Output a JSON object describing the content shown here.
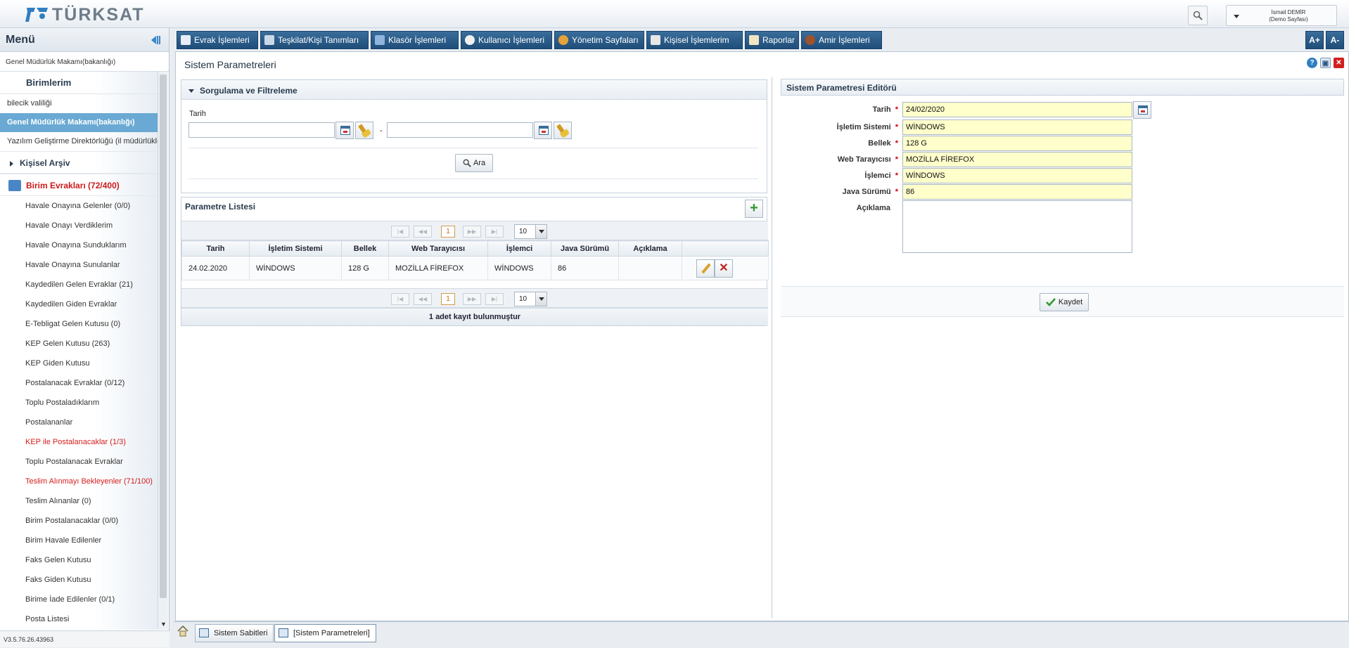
{
  "header": {
    "logo_text": "TÜRKSAT",
    "user_name": "İsmail DEMİR",
    "user_sub": "(Demo Sayfası)"
  },
  "sidebar": {
    "title": "Menü",
    "unit_select": "Genel Müdürlük Makamı(bakanlığı)",
    "birimlerim_label": "Birimlerim",
    "units": [
      "bilecik valiliği",
      "Genel Müdürlük Makamı(bakanlığı)",
      "Yazılım Geliştirme Direktörlüğü (il müdürlükleri)"
    ],
    "kisisel_arsiv": "Kişisel Arşiv",
    "birim_evraklari": "Birim Evrakları (72/400)",
    "items": [
      "Havale Onayına Gelenler (0/0)",
      "Havale Onayı Verdiklerim",
      "Havale Onayına Sunduklarım",
      "Havale Onayına Sunulanlar",
      "Kaydedilen Gelen Evraklar (21)",
      "Kaydedilen Giden Evraklar",
      "E-Tebligat Gelen Kutusu (0)",
      "KEP Gelen Kutusu (263)",
      "KEP Giden Kutusu",
      "Postalanacak Evraklar (0/12)",
      "Toplu Postaladıklarım",
      "Postalananlar",
      "KEP ile Postalanacaklar (1/3)",
      "Toplu Postalanacak Evraklar",
      "Teslim Alınmayı Bekleyenler (71/100)",
      "Teslim Alınanlar (0)",
      "Birim Postalanacaklar (0/0)",
      "Birim Havale Edilenler",
      "Faks Gelen Kutusu",
      "Faks Giden Kutusu",
      "Birime İade Edilenler (0/1)",
      "Posta Listesi"
    ],
    "version": "V3.5.76.26.43963"
  },
  "nav": {
    "items": [
      "Evrak İşlemleri",
      "Teşkilat/Kişi Tanımları",
      "Klasör İşlemleri",
      "Kullanıcı İşlemleri",
      "Yönetim Sayfaları",
      "Kişisel İşlemlerim",
      "Raporlar",
      "Amir İşlemleri"
    ],
    "font_up": "A+",
    "font_down": "A-"
  },
  "page": {
    "title": "Sistem Parametreleri"
  },
  "filter": {
    "title": "Sorgulama ve Filtreleme",
    "tarih_label": "Tarih",
    "dash": "-",
    "search_button": "Ara"
  },
  "list": {
    "title": "Parametre Listesi",
    "current_page": "1",
    "page_size": "10",
    "columns": [
      "Tarih",
      "İşletim Sistemi",
      "Bellek",
      "Web Tarayıcısı",
      "İşlemci",
      "Java Sürümü",
      "Açıklama"
    ],
    "rows": [
      [
        "24.02.2020",
        "WİNDOWS",
        "128 G",
        "MOZİLLA FİREFOX",
        "WİNDOWS",
        "86",
        ""
      ]
    ],
    "footer": "1 adet kayıt bulunmuştur"
  },
  "editor": {
    "title": "Sistem Parametresi Editörü",
    "fields": [
      {
        "label": "Tarih",
        "value": "24/02/2020"
      },
      {
        "label": "İşletim Sistemi",
        "value": "WİNDOWS"
      },
      {
        "label": "Bellek",
        "value": "128 G"
      },
      {
        "label": "Web Tarayıcısı",
        "value": "MOZİLLA FİREFOX"
      },
      {
        "label": "İşlemci",
        "value": "WİNDOWS"
      },
      {
        "label": "Java Sürümü",
        "value": "86"
      }
    ],
    "aciklama_label": "Açıklama",
    "required_mark": "*",
    "save_button": "Kaydet"
  },
  "bottom_tabs": [
    "Sistem Sabitleri",
    "[Sistem Parametreleri]"
  ],
  "colors": {
    "nav_bg": "#1f4e79",
    "required": "#d20000",
    "selected_unit": "#6aa9d3",
    "red_item": "#d61c1c",
    "field_bg": "#ffffcc"
  }
}
